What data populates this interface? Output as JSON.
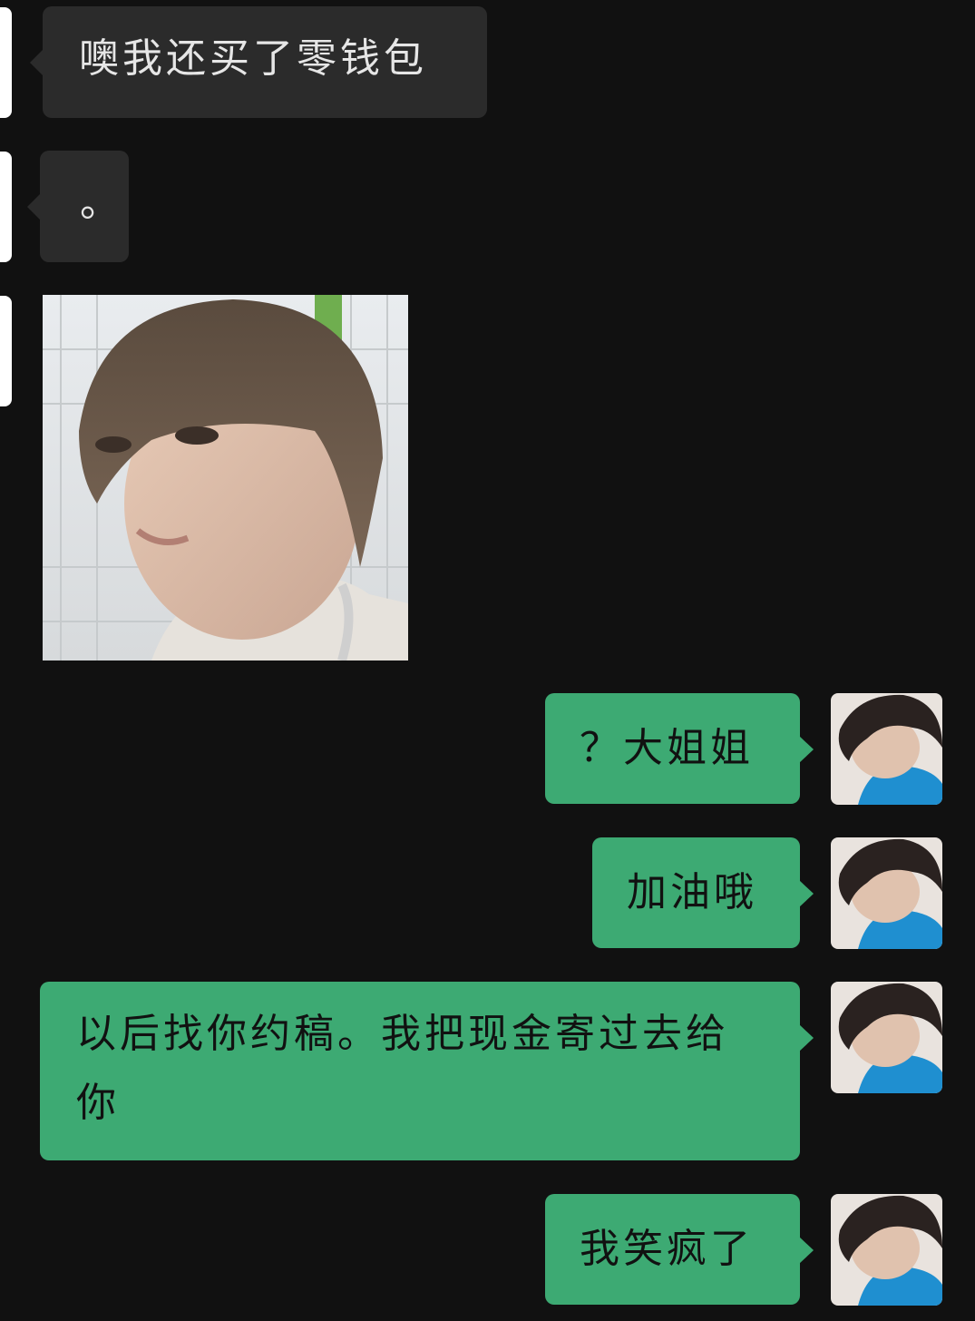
{
  "messages": [
    {
      "side": "received",
      "type": "text",
      "text": "噢我还买了零钱包"
    },
    {
      "side": "received",
      "type": "text",
      "text": "。"
    },
    {
      "side": "received",
      "type": "image",
      "icon": "selfie-photo"
    },
    {
      "side": "sent",
      "type": "text",
      "text": "？大姐姐"
    },
    {
      "side": "sent",
      "type": "text",
      "text": "加油哦"
    },
    {
      "side": "sent",
      "type": "text",
      "text": "以后找你约稿。我把现金寄过去给你"
    },
    {
      "side": "sent",
      "type": "text",
      "text": "我笑疯了"
    }
  ],
  "colors": {
    "background": "#111111",
    "received_bubble": "#2b2b2b",
    "sent_bubble": "#3daa73",
    "received_text": "#e6e6e6",
    "sent_text": "#111111"
  },
  "icons": {
    "own_avatar": "user-avatar-photo",
    "contact_avatar": "contact-avatar"
  }
}
